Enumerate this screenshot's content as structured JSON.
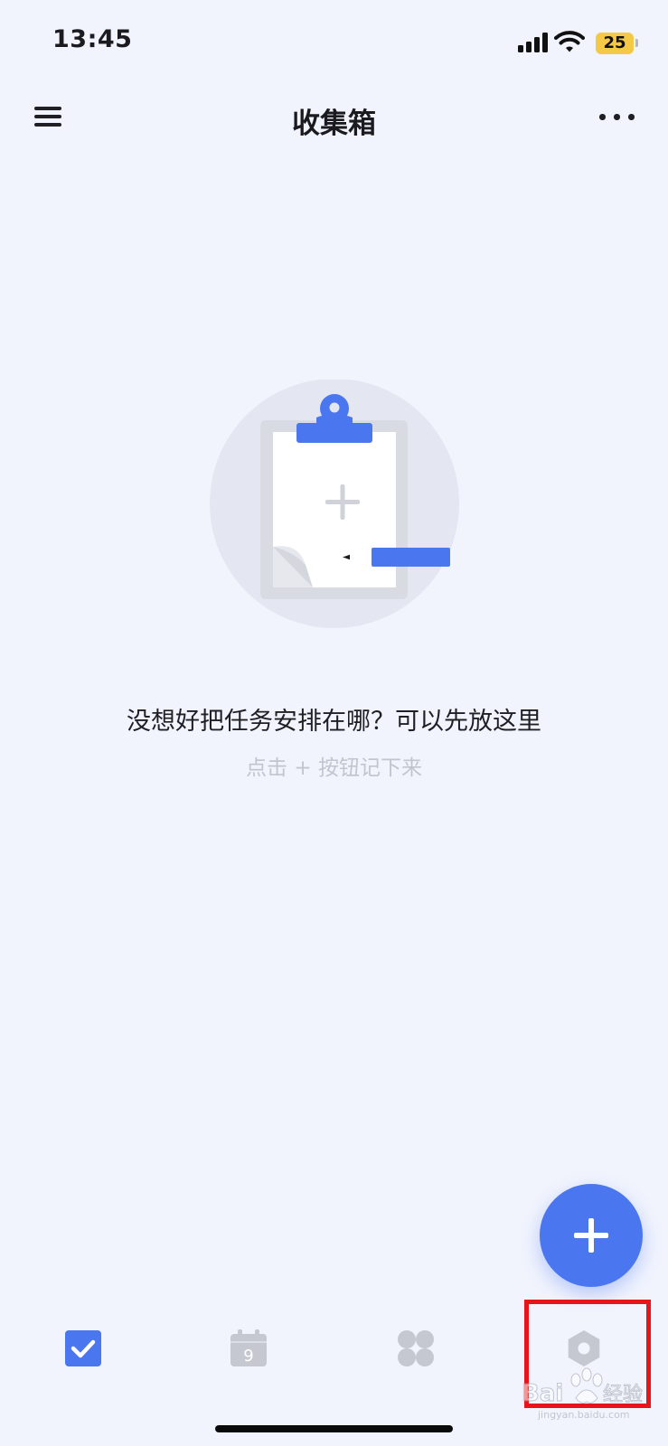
{
  "status_bar": {
    "time": "13:45",
    "battery": "25",
    "icons": [
      "signal-icon",
      "wifi-icon",
      "battery-icon"
    ]
  },
  "header": {
    "title": "收集箱",
    "left_icon": "menu-icon",
    "right_icon": "more-icon"
  },
  "empty_state": {
    "illustration": "clipboard-pencil-illustration",
    "title": "没想好把任务安排在哪？可以先放这里",
    "hint": "点击 + 按钮记下来"
  },
  "fab": {
    "icon": "plus-icon"
  },
  "tab_bar": {
    "tabs": [
      {
        "icon": "checkbox-icon",
        "active": true
      },
      {
        "icon": "calendar-icon",
        "calendar_day": "9",
        "active": false
      },
      {
        "icon": "apps-grid-icon",
        "active": false
      },
      {
        "icon": "settings-hexagon-icon",
        "active": false,
        "highlighted": true
      }
    ]
  },
  "watermark": {
    "text": "Baidu经验",
    "url_text": "jingyan.baidu.com"
  },
  "colors": {
    "background": "#f1f4fd",
    "accent": "#4a76f0",
    "inactive_icon": "#c5c8d0",
    "highlight": "#e8141a",
    "battery": "#f4c945"
  }
}
